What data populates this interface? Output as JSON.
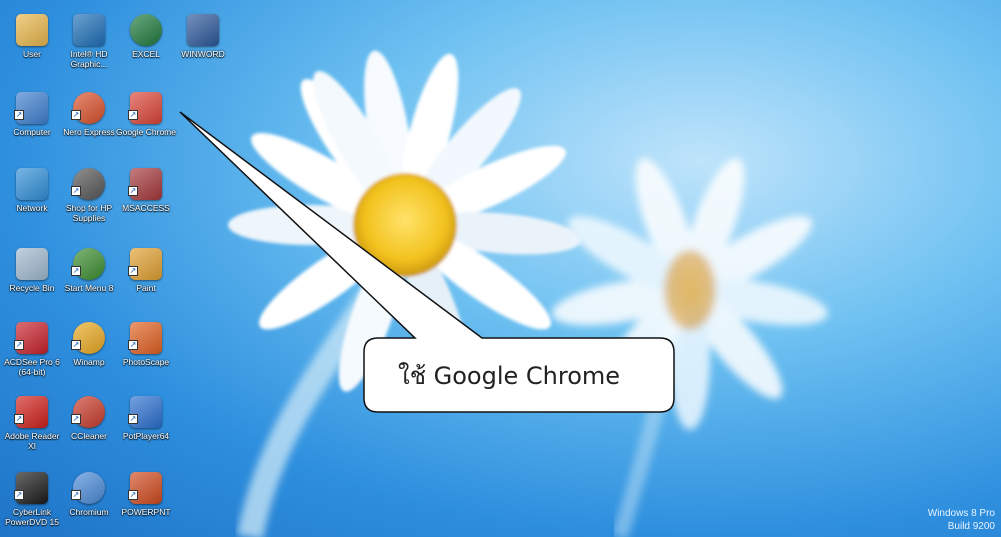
{
  "desktop": {
    "icons": [
      {
        "label": "User",
        "icon": "user-folder-icon",
        "color": "#e8b64a"
      },
      {
        "label": "Intel® HD Graphic...",
        "icon": "intel-graphics-icon",
        "color": "#1d6fb8"
      },
      {
        "label": "EXCEL",
        "icon": "excel-icon",
        "color": "#1e7a3c"
      },
      {
        "label": "WINWORD",
        "icon": "word-icon",
        "color": "#2b579a"
      },
      {
        "label": "Computer",
        "icon": "computer-icon",
        "color": "#3d7fd0"
      },
      {
        "label": "Nero Express",
        "icon": "nero-icon",
        "color": "#d9502a"
      },
      {
        "label": "Google Chrome",
        "icon": "chrome-icon",
        "color": "#db4437"
      },
      {
        "label": "Network",
        "icon": "network-icon",
        "color": "#2f8fd8"
      },
      {
        "label": "Shop for HP Supplies",
        "icon": "hp-shop-icon",
        "color": "#555555"
      },
      {
        "label": "MSACCESS",
        "icon": "access-icon",
        "color": "#a4373a"
      },
      {
        "label": "Recycle Bin",
        "icon": "recycle-bin-icon",
        "color": "#9fb9cf"
      },
      {
        "label": "Start Menu 8",
        "icon": "start-menu-icon",
        "color": "#3c8d2f"
      },
      {
        "label": "Paint",
        "icon": "paint-icon",
        "color": "#e0a030"
      },
      {
        "label": "ACDSee Pro 6 (64-bit)",
        "icon": "acdsee-icon",
        "color": "#c8202a"
      },
      {
        "label": "Winamp",
        "icon": "winamp-icon",
        "color": "#e8a820"
      },
      {
        "label": "PhotoScape",
        "icon": "photoscape-icon",
        "color": "#e06020"
      },
      {
        "label": "Adobe Reader XI",
        "icon": "adobe-reader-icon",
        "color": "#d0201a"
      },
      {
        "label": "CCleaner",
        "icon": "ccleaner-icon",
        "color": "#c83a2a"
      },
      {
        "label": "PotPlayer64",
        "icon": "potplayer-icon",
        "color": "#2a6fd0"
      },
      {
        "label": "CyberLink PowerDVD 15",
        "icon": "powerdvd-icon",
        "color": "#1a1a1a"
      },
      {
        "label": "Chromium",
        "icon": "chromium-icon",
        "color": "#4a8ad8"
      },
      {
        "label": "POWERPNT",
        "icon": "powerpoint-icon",
        "color": "#d04a1e"
      }
    ]
  },
  "callout": {
    "text": "ใช้ Google Chrome"
  },
  "watermark": {
    "line1": "Windows 8 Pro",
    "line2": "Build 9200"
  },
  "colors": {
    "sky": "#4aa8ec",
    "petal": "#ffffff",
    "flower_center": "#f2c21e",
    "callout_bg": "#ffffff"
  }
}
